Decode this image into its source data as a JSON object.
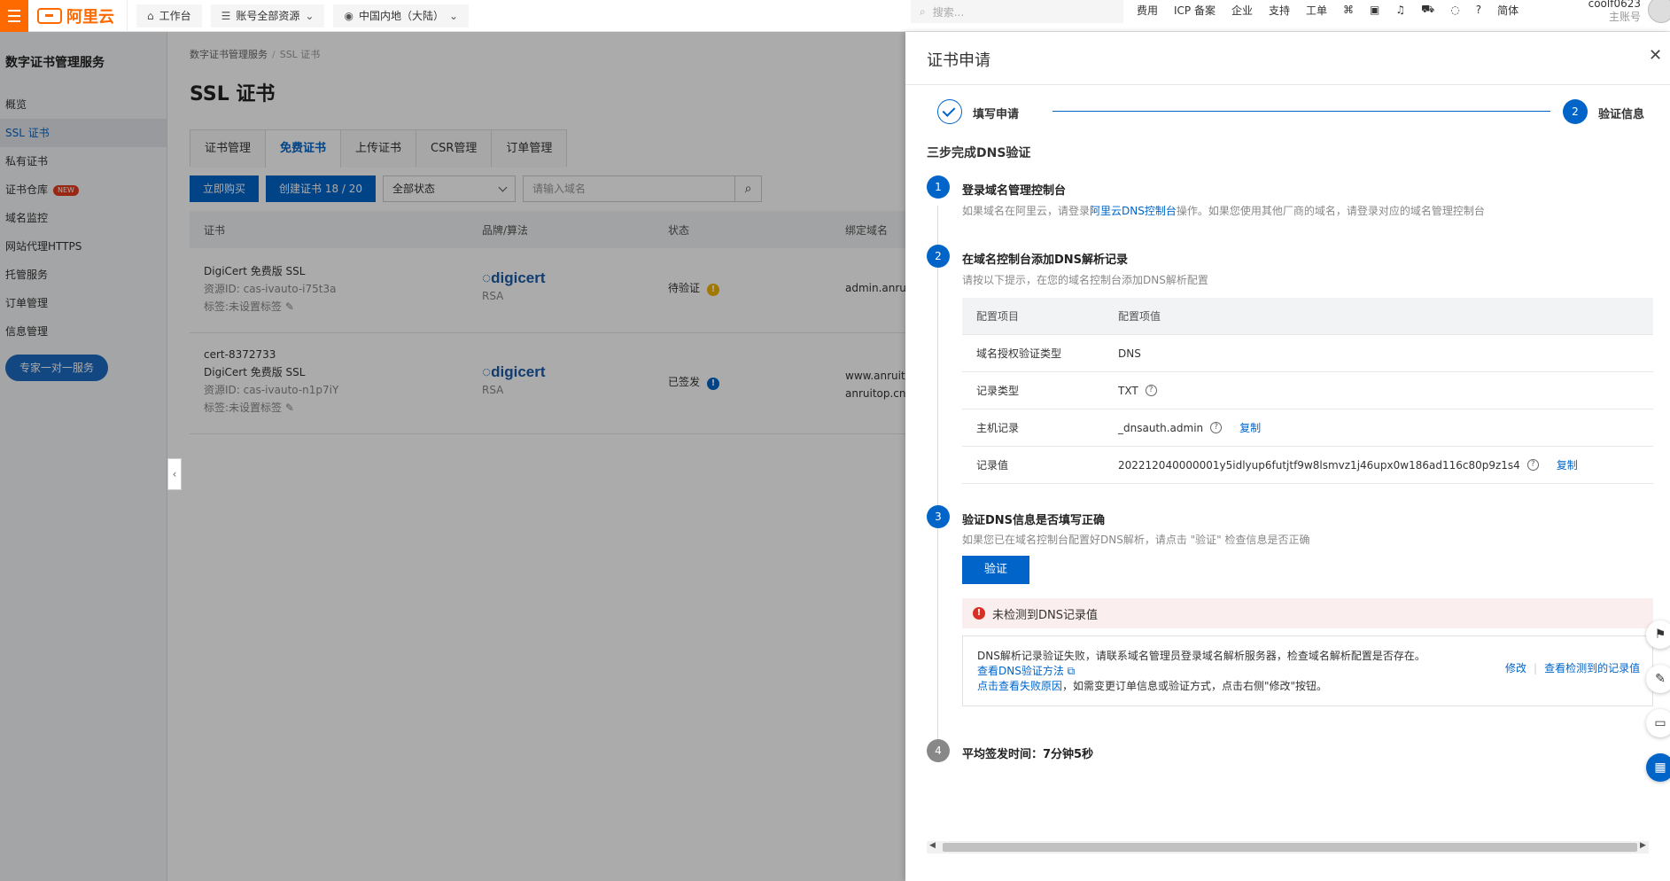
{
  "topbar": {
    "logo_text": "阿里云",
    "workbench": "工作台",
    "account_resources": "账号全部资源",
    "region": "中国内地（大陆）",
    "search_placeholder": "搜索...",
    "nav": [
      "费用",
      "ICP 备案",
      "企业",
      "支持",
      "工单"
    ],
    "lang": "简体",
    "account_name": "coolf0623",
    "account_role": "主账号"
  },
  "sidebar": {
    "title": "数字证书管理服务",
    "items": [
      {
        "label": "概览"
      },
      {
        "label": "SSL 证书",
        "active": true
      },
      {
        "label": "私有证书"
      },
      {
        "label": "证书仓库",
        "badge": "NEW"
      },
      {
        "label": "域名监控"
      },
      {
        "label": "网站代理HTTPS"
      },
      {
        "label": "托管服务"
      },
      {
        "label": "订单管理"
      },
      {
        "label": "信息管理"
      }
    ],
    "expert_button": "专家一对一服务"
  },
  "main": {
    "breadcrumb": [
      "数字证书管理服务",
      "SSL 证书"
    ],
    "title": "SSL 证书",
    "tabs": [
      "证书管理",
      "免费证书",
      "上传证书",
      "CSR管理",
      "订单管理"
    ],
    "active_tab": "免费证书",
    "buy_button": "立即购买",
    "create_button": "创建证书 18 / 20",
    "status_select": "全部状态",
    "domain_placeholder": "请输入域名",
    "columns": [
      "证书",
      "品牌/算法",
      "状态",
      "绑定域名"
    ],
    "rows": [
      {
        "line1": "DigiCert 免费版 SSL",
        "line2": "资源ID: cas-ivauto-i75t3a",
        "line3": "标签:未设置标签",
        "brand": "digicert",
        "algo": "RSA",
        "status": "待验证",
        "domain": "admin.anruito"
      },
      {
        "line0": "cert-8372733",
        "line1": "DigiCert 免费版 SSL",
        "line2": "资源ID: cas-ivauto-n1p7iY",
        "line3": "标签:未设置标签",
        "brand": "digicert",
        "algo": "RSA",
        "status": "已签发",
        "domain": "www.anruitop",
        "domain2": "anruitop.cn"
      }
    ]
  },
  "drawer": {
    "title": "证书申请",
    "step1": "填写申请",
    "step2_num": "2",
    "step2": "验证信息",
    "subtitle": "三步完成DNS验证",
    "s1_num": "1",
    "s1_title": "登录域名管理控制台",
    "s1_desc_a": "如果域名在阿里云，请登录",
    "s1_desc_link": "阿里云DNS控制台",
    "s1_desc_b": "操作。如果您使用其他厂商的域名，请登录对应的域名管理控制台",
    "s2_num": "2",
    "s2_title": "在域名控制台添加DNS解析记录",
    "s2_desc": "请按以下提示，在您的域名控制台添加DNS解析配置",
    "cfg_head_k": "配置项目",
    "cfg_head_v": "配置项值",
    "cfg_rows": [
      {
        "k": "域名授权验证类型",
        "v": "DNS"
      },
      {
        "k": "记录类型",
        "v": "TXT"
      },
      {
        "k": "主机记录",
        "v": "_dnsauth.admin",
        "copy": "复制"
      },
      {
        "k": "记录值",
        "v": "202212040000001y5idlyup6futjtf9w8lsmvz1j46upx0w186ad116c80p9z1s4",
        "copy": "复制"
      }
    ],
    "s3_num": "3",
    "s3_title": "验证DNS信息是否填写正确",
    "s3_desc": "如果您已在域名控制台配置好DNS解析，请点击 \"验证\" 检查信息是否正确",
    "verify_button": "验证",
    "error_title": "未检测到DNS记录值",
    "error_text": "DNS解析记录验证失败，请联系域名管理员登录域名解析服务器，检查域名解析配置是否存在。",
    "error_link1": "查看DNS验证方法",
    "error_link2": "点击查看失败原因",
    "error_text2": "，如需变更订单信息或验证方式，点击右侧\"修改\"按钮。",
    "action_modify": "修改",
    "action_view": "查看检测到的记录值",
    "s4_num": "4",
    "s4_title": "平均签发时间：7分钟5秒"
  },
  "colors": {
    "brand": "#ff6a00",
    "primary": "#0064c8",
    "error": "#d93026",
    "warning": "#f0b400"
  }
}
